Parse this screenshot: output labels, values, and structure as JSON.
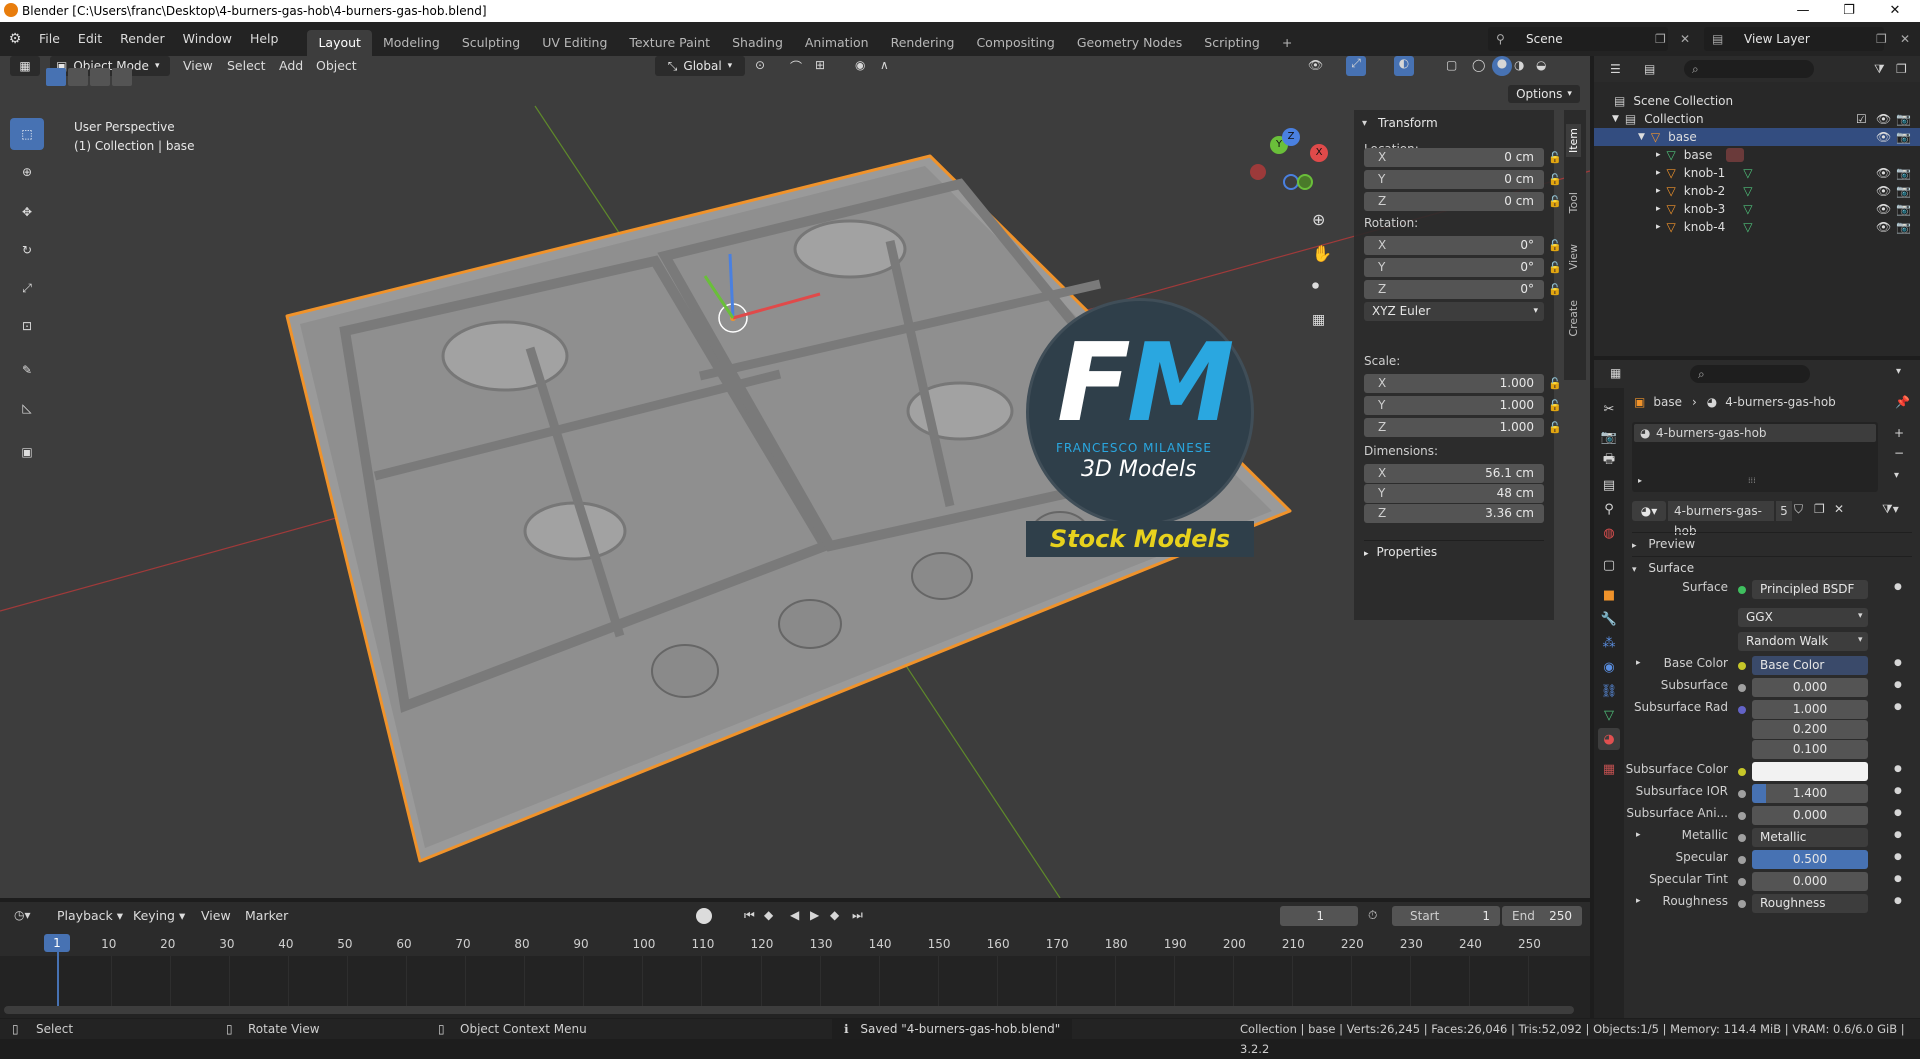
{
  "window": {
    "title": "Blender [C:\\Users\\franc\\Desktop\\4-burners-gas-hob\\4-burners-gas-hob.blend]",
    "minimize": "—",
    "maximize": "❐",
    "close": "✕"
  },
  "menus": [
    "File",
    "Edit",
    "Render",
    "Window",
    "Help"
  ],
  "workspaces": [
    "Layout",
    "Modeling",
    "Sculpting",
    "UV Editing",
    "Texture Paint",
    "Shading",
    "Animation",
    "Rendering",
    "Compositing",
    "Geometry Nodes",
    "Scripting"
  ],
  "scene": {
    "name": "Scene",
    "view_layer": "View Layer"
  },
  "viewport_header": {
    "mode": "Object Mode",
    "menus": [
      "View",
      "Select",
      "Add",
      "Object"
    ],
    "orientation": "Global",
    "options": "Options"
  },
  "viewport": {
    "perspective": "User Perspective",
    "collection_info": "(1) Collection | base"
  },
  "watermark": {
    "letters_f": "F",
    "letters_m": "M",
    "brand": "FRANCESCO MILANESE",
    "subtitle": "3D Models",
    "stock": "Stock Models"
  },
  "gizmo": {
    "x": "X",
    "y": "Y",
    "z": "Z"
  },
  "side_tabs": [
    "Item",
    "Tool",
    "View",
    "Create"
  ],
  "transform": {
    "title": "Transform",
    "location_label": "Location:",
    "rotation_label": "Rotation:",
    "scale_label": "Scale:",
    "dimensions_label": "Dimensions:",
    "location": [
      {
        "axis": "X",
        "value": "0 cm"
      },
      {
        "axis": "Y",
        "value": "0 cm"
      },
      {
        "axis": "Z",
        "value": "0 cm"
      }
    ],
    "rotation": [
      {
        "axis": "X",
        "value": "0°"
      },
      {
        "axis": "Y",
        "value": "0°"
      },
      {
        "axis": "Z",
        "value": "0°"
      }
    ],
    "rotation_mode": "XYZ Euler",
    "scale": [
      {
        "axis": "X",
        "value": "1.000"
      },
      {
        "axis": "Y",
        "value": "1.000"
      },
      {
        "axis": "Z",
        "value": "1.000"
      }
    ],
    "dimensions": [
      {
        "axis": "X",
        "value": "56.1 cm"
      },
      {
        "axis": "Y",
        "value": "48 cm"
      },
      {
        "axis": "Z",
        "value": "3.36 cm"
      }
    ],
    "properties": "Properties"
  },
  "outliner": {
    "scene_collection": "Scene Collection",
    "collection": "Collection",
    "items": [
      "base",
      "base",
      "knob-1",
      "knob-2",
      "knob-3",
      "knob-4"
    ]
  },
  "properties": {
    "breadcrumb_object": "base",
    "breadcrumb_material": "4-burners-gas-hob",
    "material_slot": "4-burners-gas-hob",
    "material_name": "4-burners-gas-hob",
    "material_users": "5",
    "preview": "Preview",
    "surface_section": "Surface",
    "rows": [
      {
        "label": "Surface",
        "value": "Principled BSDF",
        "dot": "#3fbf5f"
      },
      {
        "label": "",
        "value": "GGX"
      },
      {
        "label": "",
        "value": "Random Walk"
      },
      {
        "label": "Base Color",
        "value": "Base Color",
        "dot": "#c7c729"
      },
      {
        "label": "Subsurface",
        "value": "0.000",
        "dot": "#a0a0a0"
      },
      {
        "label": "Subsurface Rad",
        "value": "1.000",
        "dot": "#6363c7"
      },
      {
        "label": "",
        "value": "0.200"
      },
      {
        "label": "",
        "value": "0.100"
      },
      {
        "label": "Subsurface Color",
        "value": "",
        "dot": "#c7c729"
      },
      {
        "label": "Subsurface IOR",
        "value": "1.400",
        "dot": "#a0a0a0"
      },
      {
        "label": "Subsurface Ani...",
        "value": "0.000",
        "dot": "#a0a0a0"
      },
      {
        "label": "Metallic",
        "value": "Metallic",
        "dot": "#a0a0a0"
      },
      {
        "label": "Specular",
        "value": "0.500",
        "dot": "#a0a0a0"
      },
      {
        "label": "Specular Tint",
        "value": "0.000",
        "dot": "#a0a0a0"
      },
      {
        "label": "Roughness",
        "value": "Roughness",
        "dot": "#a0a0a0"
      }
    ]
  },
  "timeline": {
    "menus": [
      "Playback",
      "Keying",
      "View",
      "Marker"
    ],
    "current_frame": "1",
    "start_label": "Start",
    "start": "1",
    "end_label": "End",
    "end": "250",
    "ticks": [
      "1",
      "10",
      "20",
      "30",
      "40",
      "50",
      "60",
      "70",
      "80",
      "90",
      "100",
      "110",
      "120",
      "130",
      "140",
      "150",
      "160",
      "170",
      "180",
      "190",
      "200",
      "210",
      "220",
      "230",
      "240",
      "250"
    ]
  },
  "status": {
    "select": "Select",
    "rotate": "Rotate View",
    "context": "Object Context Menu",
    "saved": "Saved \"4-burners-gas-hob.blend\"",
    "stats": "Collection | base | Verts:26,245 | Faces:26,046 | Tris:52,092 | Objects:1/5 | Memory: 114.4 MiB | VRAM: 0.6/6.0 GiB | 3.2.2"
  },
  "colors": {
    "accent": "#4772b3",
    "selection_orange": "#f0932b",
    "fm_blue": "#2aa7e0",
    "stock_yellow": "#e8d21d"
  }
}
